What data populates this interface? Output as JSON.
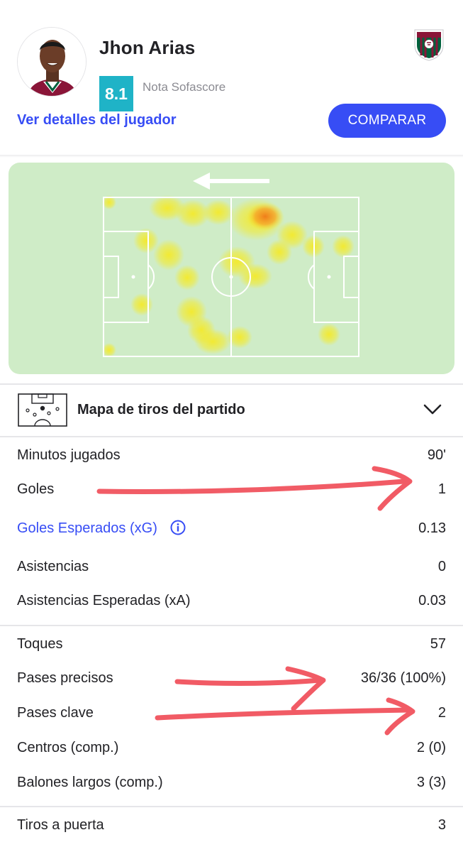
{
  "player": {
    "name": "Jhon Arias",
    "rating": "8.1",
    "rating_label": "Nota Sofascore",
    "details_link": "Ver detalles del jugador",
    "compare_label": "COMPARAR",
    "rating_color": "#1fb3c7",
    "accent_color": "#374df5",
    "club_colors": [
      "#8a1538",
      "#00613c",
      "#ffffff"
    ]
  },
  "heatmap": {
    "direction": "left",
    "pitch_color": "#cfecc7"
  },
  "shot_map": {
    "title": "Mapa de tiros del partido",
    "icons": [
      "pitch-icon",
      "chevron-down-icon"
    ]
  },
  "stats": {
    "group1": [
      {
        "label": "Minutos jugados",
        "value": "90'"
      },
      {
        "label": "Goles",
        "value": "1"
      },
      {
        "label": "Goles Esperados (xG)",
        "value": "0.13"
      },
      {
        "label": "Asistencias",
        "value": "0"
      },
      {
        "label": "Asistencias Esperadas (xA)",
        "value": "0.03"
      }
    ],
    "group2": [
      {
        "label": "Toques",
        "value": "57"
      },
      {
        "label": "Pases precisos",
        "value": "36/36 (100%)"
      },
      {
        "label": "Pases clave",
        "value": "2"
      },
      {
        "label": "Centros (comp.)",
        "value": "2 (0)"
      },
      {
        "label": "Balones largos (comp.)",
        "value": "3 (3)"
      }
    ],
    "group3": [
      {
        "label": "Tiros a puerta",
        "value": "3"
      }
    ]
  },
  "annotation_color": "#f04a55"
}
